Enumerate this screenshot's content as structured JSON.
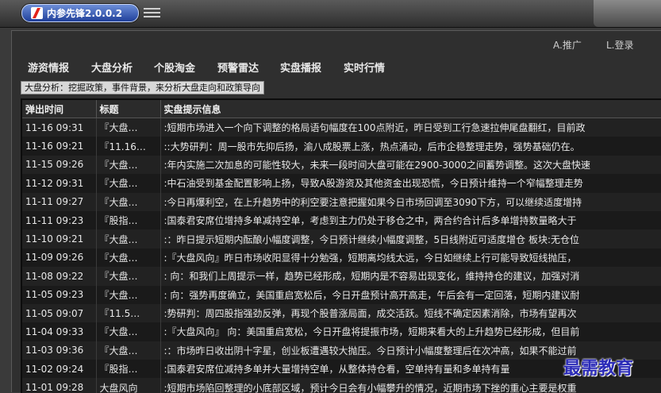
{
  "app": {
    "title": "内参先锋2.0.0.2"
  },
  "toplinks": {
    "promote": "A.推广",
    "login": "L.登录"
  },
  "nav": [
    "游资情报",
    "大盘分析",
    "个股淘金",
    "预警雷达",
    "实盘播报",
    "实时行情"
  ],
  "breadcrumb": "大盘分析：挖掘政策，事件背景，来分析大盘走向和政策导向",
  "table": {
    "columns": [
      "弹出时间",
      "标题",
      "实盘提示信息"
    ],
    "rows": [
      [
        "11-16 09:31",
        "『大盘…",
        ":短期市场进入一个向下调整的格局语句幅度在100点附近，昨日受到工行急速拉伸尾盘翻红，目前政"
      ],
      [
        "11-16 09:21",
        "『11.16…",
        "::大势研判：周一股市先抑后扬，渝八成股票上涨，热点涌动，后市企稳整理走势，强势基础仍在。"
      ],
      [
        "11-15 09:26",
        "『大盘…",
        ":年内实施二次加息的可能性较大，未来一段时间大盘可能在2900-3000之间蓄势调整。这次大盘快速"
      ],
      [
        "11-12 09:31",
        "『大盘…",
        ":中石油受到基金配置影响上扬，导致A股游资及其他资金出现恐慌，今日预计维持一个窄幅整理走势"
      ],
      [
        "11-11 09:27",
        "『大盘…",
        ":今日再爆利空，在上升趋势中的利空要注意把握如果今日市场回调至3090下方，可以继续适度增持"
      ],
      [
        "11-11 09:23",
        "『股指…",
        ":国泰君安席位增持多单减持空单，考虑到主力仍处于移仓之中，两合约合计后多单增持数量略大于"
      ],
      [
        "11-10 09:21",
        "『大盘…",
        ":：昨日提示短期内酝酿小幅度调整，今日预计继续小幅度调整，5日线附近可适度增仓 板块:无仓位"
      ],
      [
        "11-09 09:26",
        "『大盘…",
        ":『大盘风向』昨日市场收阳显得十分勉强，短期离均线太远，今日如继续上行可能导致短线抛压，"
      ],
      [
        "11-08 09:22",
        "『大盘…",
        ": 向：和我们上周提示一样，趋势已经形成，短期内是不容易出现变化，维持持仓的建议，加强对消"
      ],
      [
        "11-05 09:23",
        "『大盘…",
        ": 向：强势再度确立，美国重启宽松后，今日开盘预计高开高走，午后会有一定回落，短期内建议耐"
      ],
      [
        "11-05 09:07",
        "『11.5…",
        ":势研判：周四股指强劲反弹，再现个股普涨局面，成交活跃。短线不确定因素消除，市场有望再次"
      ],
      [
        "11-04 09:33",
        "『大盘…",
        ":『大盘风向』 向：美国重启宽松，今日开盘将提振市场，短期来看大的上升趋势已经形成，但目前"
      ],
      [
        "11-03 09:36",
        "『大盘…",
        ":：市场昨日收出阴十字星，创业板遭遇较大抛压。今日预计小幅度整理后在次冲高，如果不能过前"
      ],
      [
        "11-02 09:24",
        "『股指…",
        ":国泰君安席位减持多单并大量增持空单，从整体持仓看，空单持有量和多单持有量"
      ],
      [
        "11-01 09:28",
        "大盘风向",
        ":短期市场陷回整理的小底部区域，预计今日会有小幅攀升的情况，近期市场下挫的重心主要是权重"
      ]
    ]
  },
  "watermark": "最需教育"
}
